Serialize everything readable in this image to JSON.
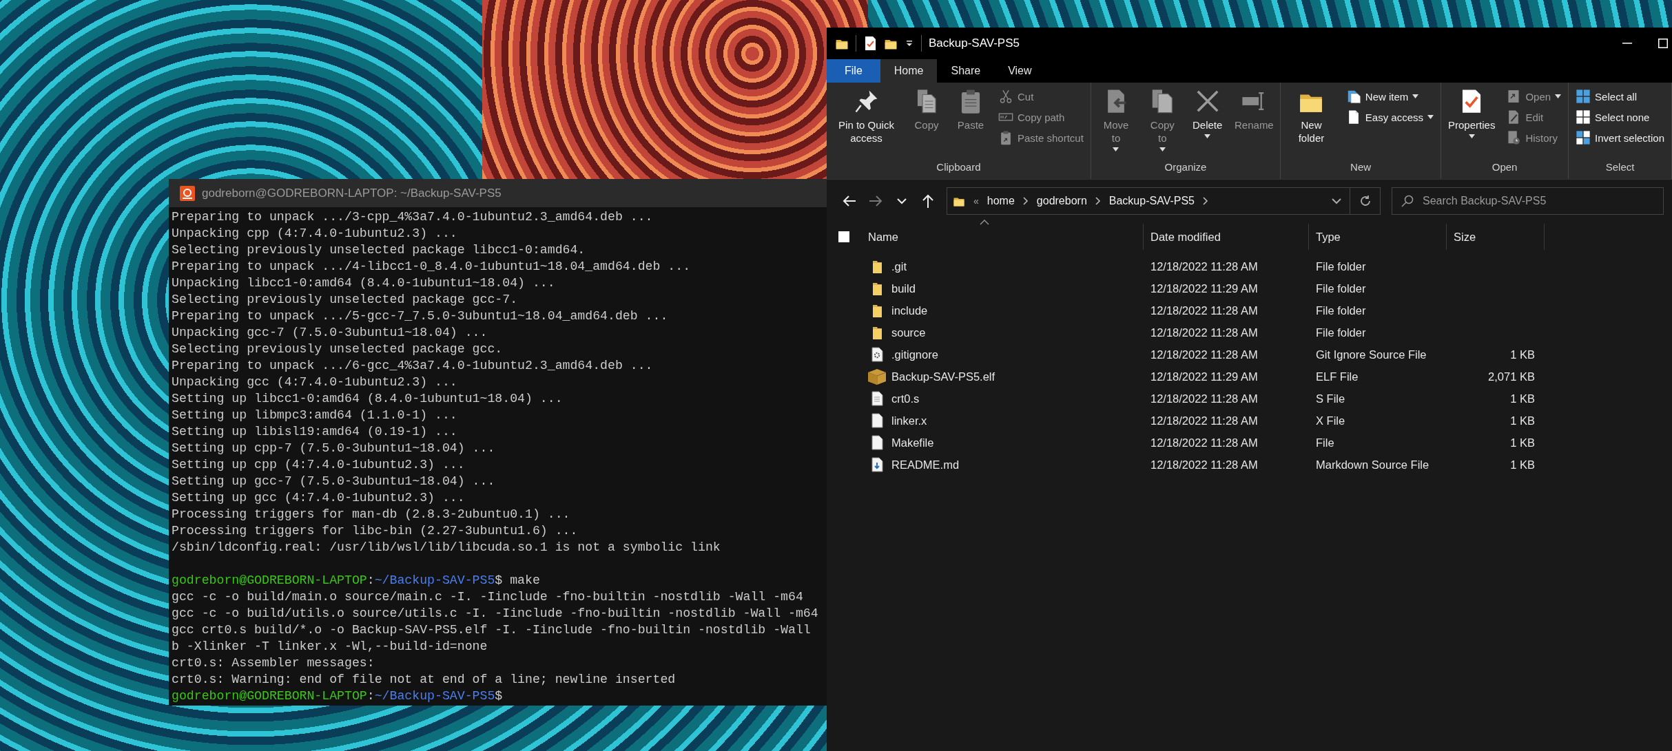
{
  "terminal": {
    "title": "godreborn@GODREBORN-LAPTOP: ~/Backup-SAV-PS5",
    "lines": [
      {
        "kind": "output",
        "text": "Preparing to unpack .../3-cpp_4%3a7.4.0-1ubuntu2.3_amd64.deb ..."
      },
      {
        "kind": "output",
        "text": "Unpacking cpp (4:7.4.0-1ubuntu2.3) ..."
      },
      {
        "kind": "output",
        "text": "Selecting previously unselected package libcc1-0:amd64."
      },
      {
        "kind": "output",
        "text": "Preparing to unpack .../4-libcc1-0_8.4.0-1ubuntu1~18.04_amd64.deb ..."
      },
      {
        "kind": "output",
        "text": "Unpacking libcc1-0:amd64 (8.4.0-1ubuntu1~18.04) ..."
      },
      {
        "kind": "output",
        "text": "Selecting previously unselected package gcc-7."
      },
      {
        "kind": "output",
        "text": "Preparing to unpack .../5-gcc-7_7.5.0-3ubuntu1~18.04_amd64.deb ..."
      },
      {
        "kind": "output",
        "text": "Unpacking gcc-7 (7.5.0-3ubuntu1~18.04) ..."
      },
      {
        "kind": "output",
        "text": "Selecting previously unselected package gcc."
      },
      {
        "kind": "output",
        "text": "Preparing to unpack .../6-gcc_4%3a7.4.0-1ubuntu2.3_amd64.deb ..."
      },
      {
        "kind": "output",
        "text": "Unpacking gcc (4:7.4.0-1ubuntu2.3) ..."
      },
      {
        "kind": "output",
        "text": "Setting up libcc1-0:amd64 (8.4.0-1ubuntu1~18.04) ..."
      },
      {
        "kind": "output",
        "text": "Setting up libmpc3:amd64 (1.1.0-1) ..."
      },
      {
        "kind": "output",
        "text": "Setting up libisl19:amd64 (0.19-1) ..."
      },
      {
        "kind": "output",
        "text": "Setting up cpp-7 (7.5.0-3ubuntu1~18.04) ..."
      },
      {
        "kind": "output",
        "text": "Setting up cpp (4:7.4.0-1ubuntu2.3) ..."
      },
      {
        "kind": "output",
        "text": "Setting up gcc-7 (7.5.0-3ubuntu1~18.04) ..."
      },
      {
        "kind": "output",
        "text": "Setting up gcc (4:7.4.0-1ubuntu2.3) ..."
      },
      {
        "kind": "output",
        "text": "Processing triggers for man-db (2.8.3-2ubuntu0.1) ..."
      },
      {
        "kind": "output",
        "text": "Processing triggers for libc-bin (2.27-3ubuntu1.6) ..."
      },
      {
        "kind": "output",
        "text": "/sbin/ldconfig.real: /usr/lib/wsl/lib/libcuda.so.1 is not a symbolic link"
      },
      {
        "kind": "blank"
      },
      {
        "kind": "prompt",
        "user": "godreborn@GODREBORN-LAPTOP",
        "separator": ":",
        "path": "~/Backup-SAV-PS5",
        "command": "$ make"
      },
      {
        "kind": "output",
        "text": "gcc -c -o build/main.o source/main.c -I. -Iinclude -fno-builtin -nostdlib -Wall -m64"
      },
      {
        "kind": "output",
        "text": "gcc -c -o build/utils.o source/utils.c -I. -Iinclude -fno-builtin -nostdlib -Wall -m64"
      },
      {
        "kind": "output",
        "text": "gcc crt0.s build/*.o -o Backup-SAV-PS5.elf -I. -Iinclude -fno-builtin -nostdlib -Wall"
      },
      {
        "kind": "output",
        "text": "b -Xlinker -T linker.x -Wl,--build-id=none"
      },
      {
        "kind": "output",
        "text": "crt0.s: Assembler messages:"
      },
      {
        "kind": "output",
        "text": "crt0.s: Warning: end of file not at end of a line; newline inserted"
      },
      {
        "kind": "prompt",
        "user": "godreborn@GODREBORN-LAPTOP",
        "separator": ":",
        "path": "~/Backup-SAV-PS5",
        "command": "$"
      }
    ]
  },
  "explorer": {
    "title": "Backup-SAV-PS5",
    "tabs": [
      {
        "label": "File",
        "kind": "menu",
        "selected": false
      },
      {
        "label": "Home",
        "kind": "tab",
        "selected": true
      },
      {
        "label": "Share",
        "kind": "tab",
        "selected": false
      },
      {
        "label": "View",
        "kind": "tab",
        "selected": false
      }
    ],
    "ribbon_groups": [
      {
        "label": "Clipboard",
        "items": [
          {
            "label": "Pin to Quick access",
            "large": true,
            "kind": "pin",
            "disabled": false,
            "dropdown": false
          },
          {
            "label": "Copy",
            "large": true,
            "kind": "copy",
            "disabled": true,
            "dropdown": false
          },
          {
            "label": "Paste",
            "large": true,
            "kind": "paste",
            "disabled": true,
            "dropdown": false
          },
          {
            "label": "Cut",
            "large": false,
            "kind": "cut",
            "disabled": true,
            "dropdown": false
          },
          {
            "label": "Copy path",
            "large": false,
            "kind": "copypath",
            "disabled": true,
            "dropdown": false
          },
          {
            "label": "Paste shortcut",
            "large": false,
            "kind": "pasteshortcut",
            "disabled": true,
            "dropdown": false
          }
        ]
      },
      {
        "label": "Organize",
        "items": [
          {
            "label": "Move to",
            "large": true,
            "kind": "moveto",
            "disabled": true,
            "dropdown": true
          },
          {
            "label": "Copy to",
            "large": true,
            "kind": "copyto",
            "disabled": true,
            "dropdown": true
          },
          {
            "label": "Delete",
            "large": true,
            "kind": "delete",
            "disabled": false,
            "dropdown": true
          },
          {
            "label": "Rename",
            "large": true,
            "kind": "rename",
            "disabled": true,
            "dropdown": false
          }
        ]
      },
      {
        "label": "New",
        "items": [
          {
            "label": "New folder",
            "large": true,
            "kind": "newfolder",
            "disabled": false,
            "dropdown": false
          },
          {
            "label": "New item",
            "large": false,
            "kind": "newitem",
            "disabled": false,
            "dropdown": true
          },
          {
            "label": "Easy access",
            "large": false,
            "kind": "easyaccess",
            "disabled": false,
            "dropdown": true
          }
        ]
      },
      {
        "label": "Open",
        "items": [
          {
            "label": "Properties",
            "large": true,
            "kind": "properties",
            "disabled": false,
            "dropdown": true
          },
          {
            "label": "Open",
            "large": false,
            "kind": "open",
            "disabled": true,
            "dropdown": true
          },
          {
            "label": "Edit",
            "large": false,
            "kind": "edit",
            "disabled": true,
            "dropdown": false
          },
          {
            "label": "History",
            "large": false,
            "kind": "history",
            "disabled": true,
            "dropdown": false
          }
        ]
      },
      {
        "label": "Select",
        "items": [
          {
            "label": "Select all",
            "large": false,
            "kind": "selectall",
            "disabled": false,
            "dropdown": false
          },
          {
            "label": "Select none",
            "large": false,
            "kind": "selectnone",
            "disabled": false,
            "dropdown": false
          },
          {
            "label": "Invert selection",
            "large": false,
            "kind": "invert",
            "disabled": false,
            "dropdown": false
          }
        ]
      }
    ],
    "navigation": [
      {
        "kind": "back",
        "disabled": false
      },
      {
        "kind": "forward",
        "disabled": true
      },
      {
        "kind": "recent",
        "disabled": false
      },
      {
        "kind": "up",
        "disabled": false
      }
    ],
    "address_bar": {
      "overflow_marker": "«",
      "crumbs": [
        "home",
        "godreborn",
        "Backup-SAV-PS5"
      ]
    },
    "search": {
      "placeholder": "Search Backup-SAV-PS5"
    },
    "header_checkbox": {
      "checked": false
    },
    "columns": [
      "Name",
      "Date modified",
      "Type",
      "Size"
    ],
    "rows": [
      {
        "kind": "folder",
        "name": ".git",
        "date": "12/18/2022 11:28 AM",
        "type": "File folder"
      },
      {
        "kind": "folder",
        "name": "build",
        "date": "12/18/2022 11:29 AM",
        "type": "File folder"
      },
      {
        "kind": "folder",
        "name": "include",
        "date": "12/18/2022 11:28 AM",
        "type": "File folder"
      },
      {
        "kind": "folder",
        "name": "source",
        "date": "12/18/2022 11:28 AM",
        "type": "File folder"
      },
      {
        "kind": "config",
        "name": ".gitignore",
        "date": "12/18/2022 11:28 AM",
        "type": "Git Ignore Source File",
        "size": "1 KB"
      },
      {
        "kind": "package",
        "name": "Backup-SAV-PS5.elf",
        "date": "12/18/2022 11:29 AM",
        "type": "ELF File",
        "size": "2,071 KB"
      },
      {
        "kind": "text",
        "name": "crt0.s",
        "date": "12/18/2022 11:28 AM",
        "type": "S File",
        "size": "1 KB"
      },
      {
        "kind": "blank",
        "name": "linker.x",
        "date": "12/18/2022 11:28 AM",
        "type": "X File",
        "size": "1 KB"
      },
      {
        "kind": "blank",
        "name": "Makefile",
        "date": "12/18/2022 11:28 AM",
        "type": "File",
        "size": "1 KB"
      },
      {
        "kind": "markdown",
        "name": "README.md",
        "date": "12/18/2022 11:28 AM",
        "type": "Markdown Source File",
        "size": "1 KB"
      }
    ]
  }
}
